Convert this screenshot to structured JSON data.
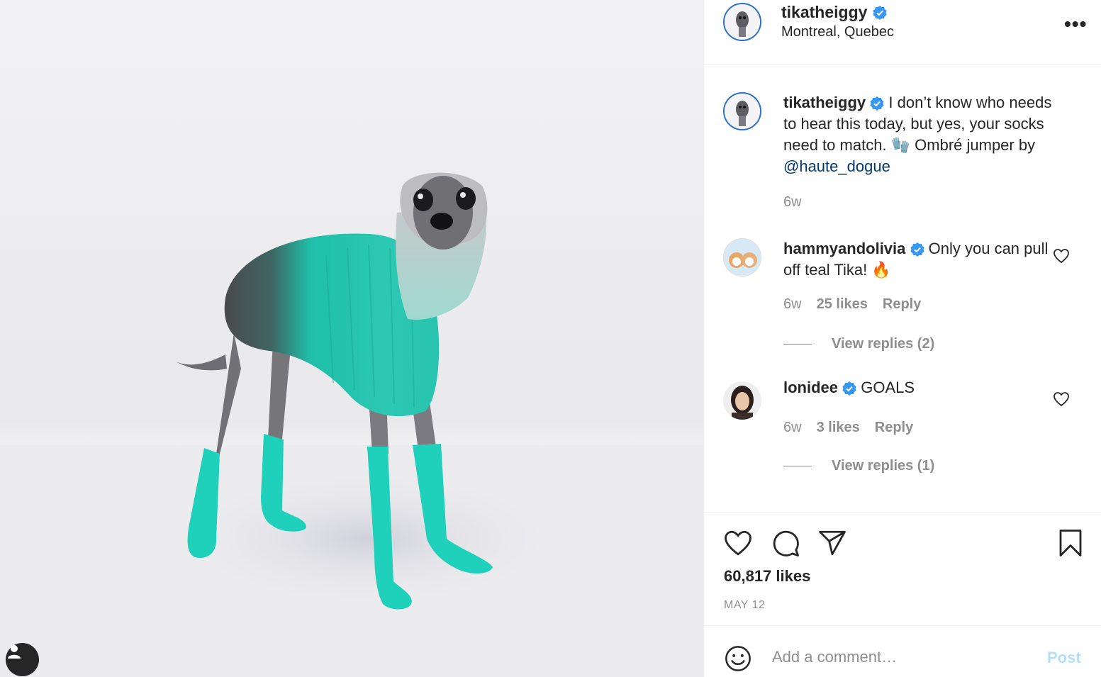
{
  "post": {
    "username": "tikatheiggy",
    "location": "Montreal, Quebec",
    "more_icon": "more-options-icon",
    "more_label": "•••",
    "caption": {
      "username": "tikatheiggy",
      "text": "I don’t know who needs to hear this today, but yes, your socks need to match. 🧤 Ombré jumper by ",
      "mention": "@haute_dogue",
      "age": "6w"
    },
    "comments": [
      {
        "username": "hammyandolivia",
        "text": "Only you can pull off teal Tika! 🔥",
        "age": "6w",
        "likes": "25 likes",
        "reply_label": "Reply",
        "view_replies": "View replies (2)"
      },
      {
        "username": "lonidee",
        "text": "GOALS",
        "age": "6w",
        "likes": "3 likes",
        "reply_label": "Reply",
        "view_replies": "View replies (1)"
      }
    ],
    "likes_count": "60,817 likes",
    "date": "MAY 12",
    "add_comment_placeholder": "Add a comment…",
    "post_button": "Post"
  },
  "colors": {
    "verified": "#3897f0",
    "mention": "#00376b",
    "muted": "#8e8e8e",
    "post_button_disabled": "#b2dffc",
    "sweater_teal": "#1fc8b4"
  }
}
